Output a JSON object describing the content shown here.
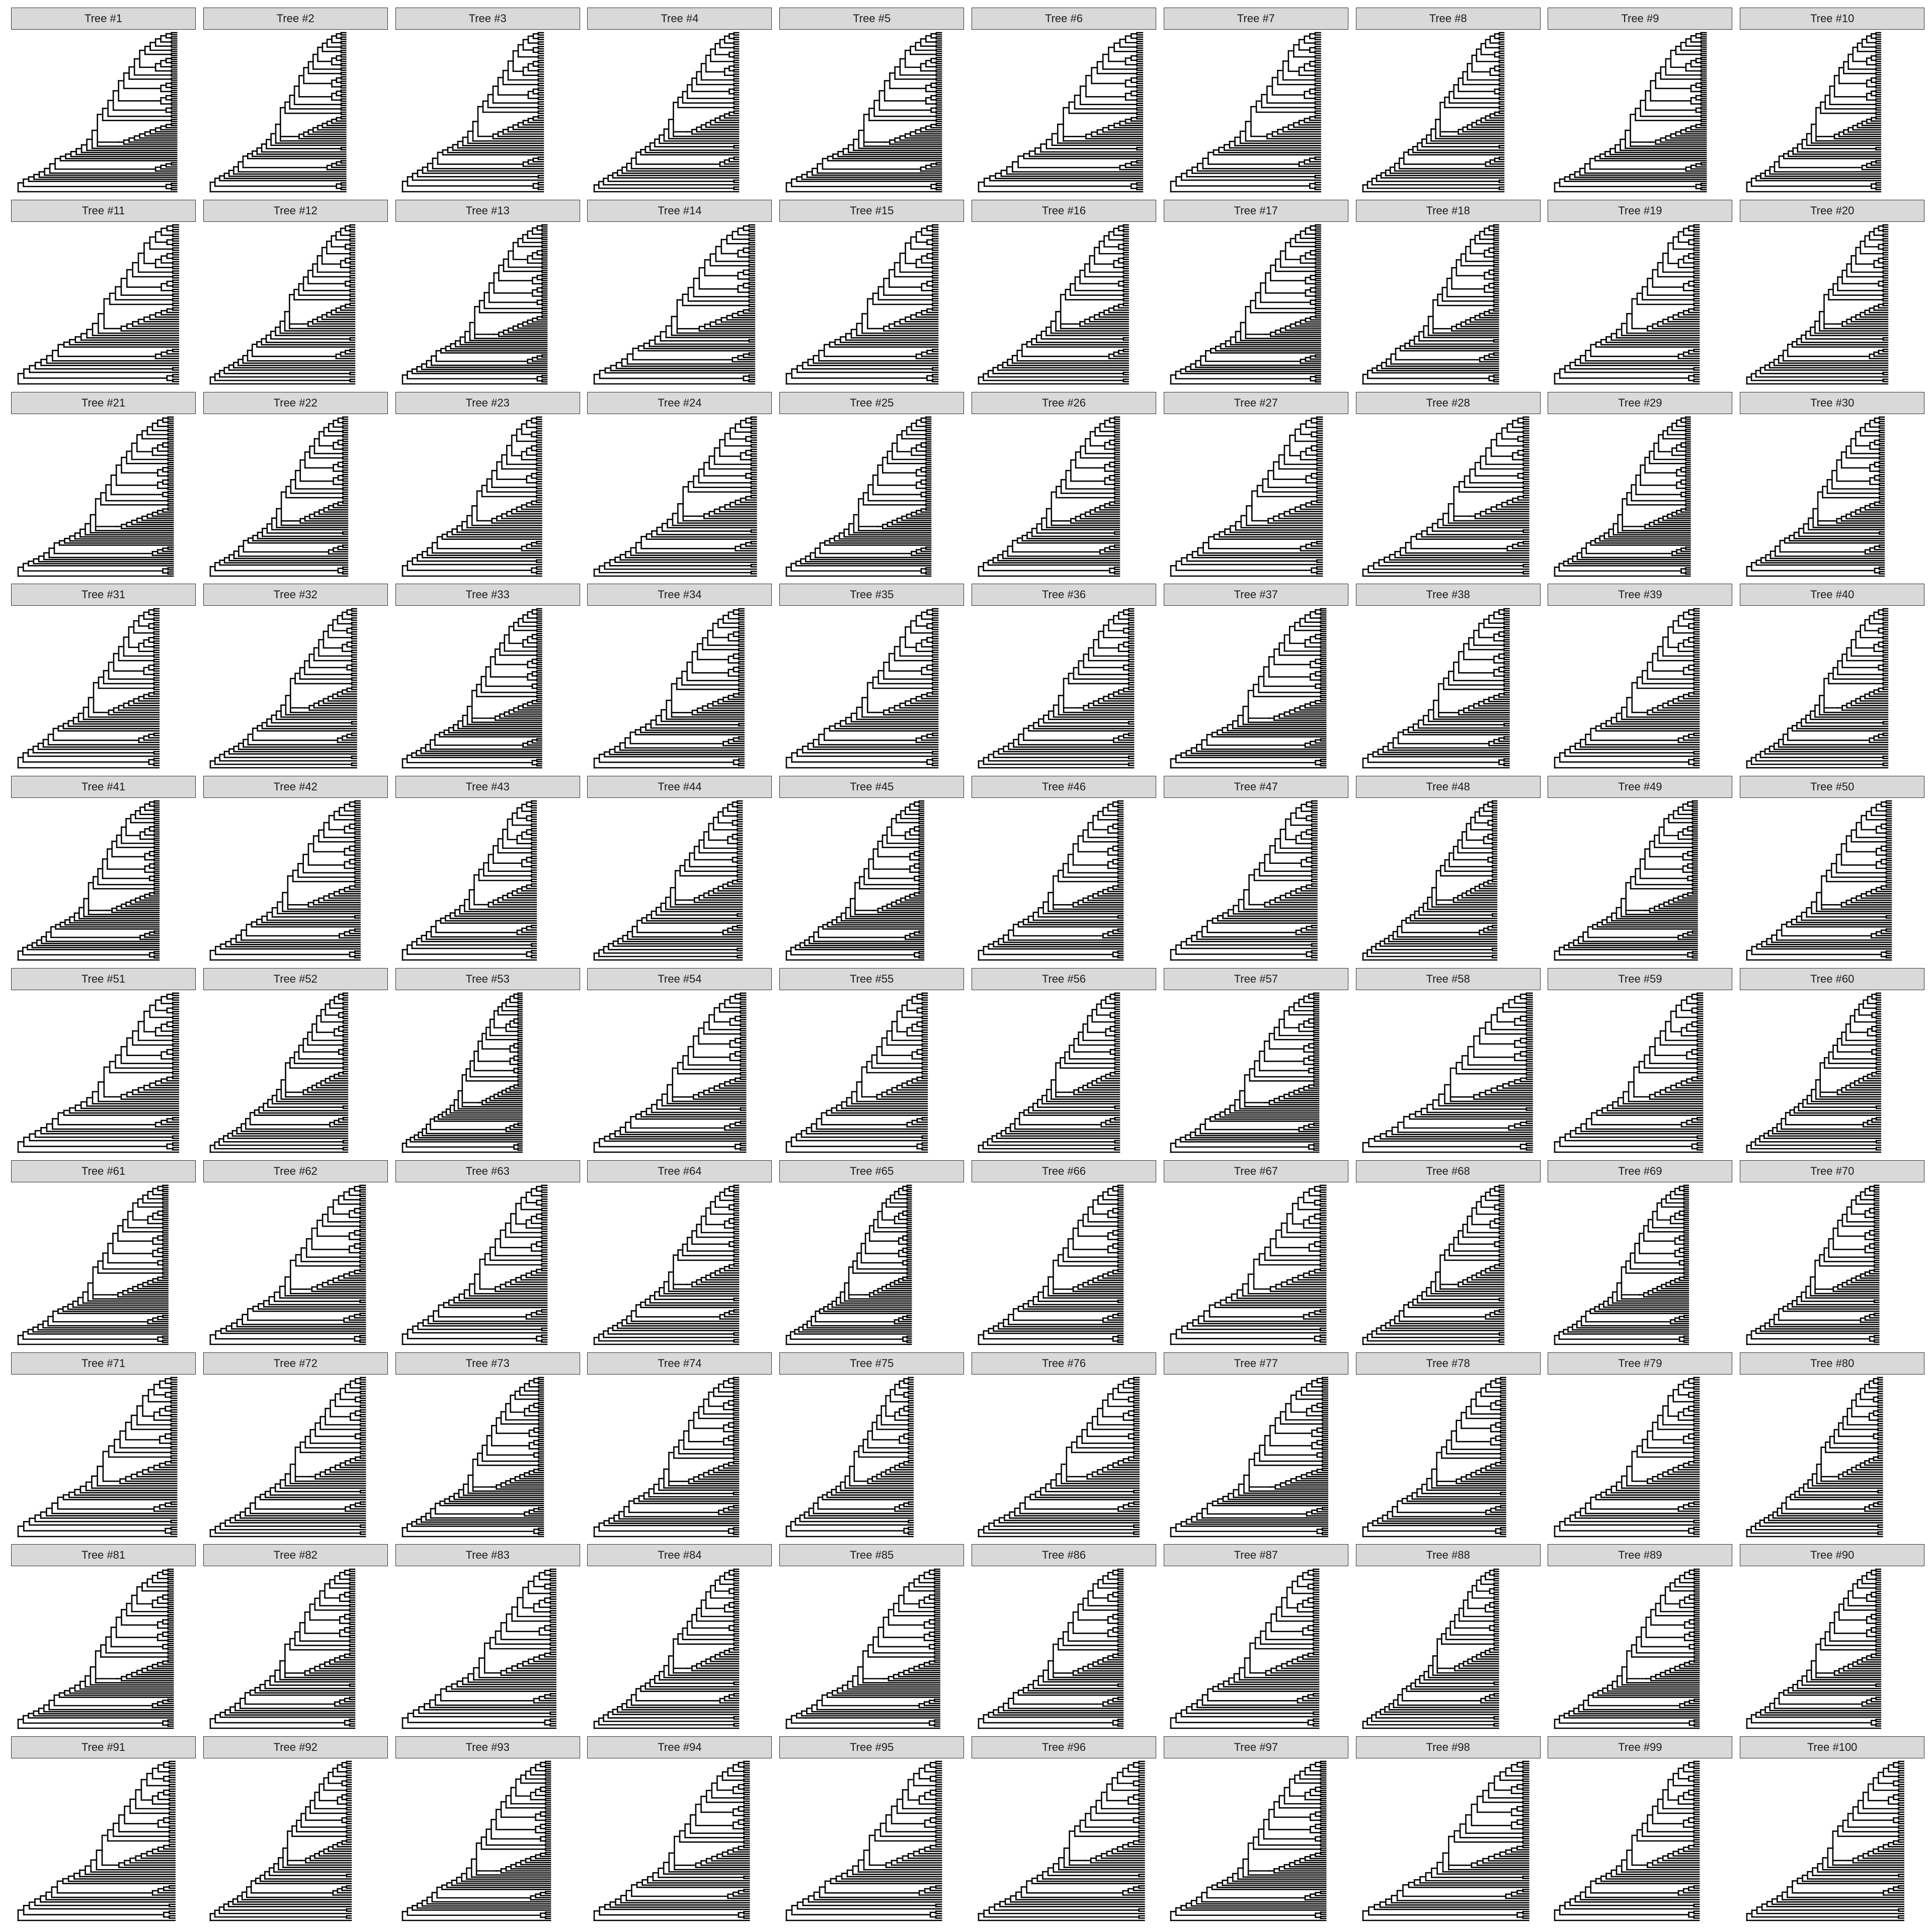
{
  "figure": {
    "title": "",
    "panel_label_prefix": "Tree #",
    "strip_fill": "#d9d9d9",
    "strip_border": "#333333",
    "branch_color": "#000000",
    "columns": 10,
    "rows": 10
  },
  "chart_data": {
    "type": "tree",
    "description": "Faceted grid of 100 ladderized rectangular cladograms",
    "topologies": [
      "((((((((((((((((((((((((((((((A,A),(A,A)),(A,A)),(A,A)),(A,A)),(A,A)),((((A,A),(A,A)),(A,A)),(A,A))),(A,A)),(A,A)),(((A,A),(A,A)),(A,A))),(((A,A),(A,A)),(A,A))),((A,A),(A,A))),(A,A)),(A,A)),(((((((((((A,A),A),A),A),A),A),A),A),A),A)),A),A),A),A),A),A),A),A),((((A,A),A),A),A)),A),A),A),A),A),((A,A),(A,A))),A),(A,A)),A)",
      "(((((((((((((((((((((((((((((A,A),(A,A)),(A,A)),(A,A)),(A,A)),(((A,A),(A,A)),(A,A))),(A,A)),(A,A)),(((A,A),(A,A)),(A,A))),(((A,A),(A,A)),(A,A))),(A,A)),(A,A)),(A,A)),(((((((((((A,A),A),A),A),A),A),A),A),A),A)),A),A),A),(A,A)),A),A),A),A),((((A,A),A),A),A)),A),A),A),A),A),((A,A),(A,A))),A),A)",
      "((((((((((((((((((((((((((((A,A),(A,A)),(A,A)),((A,A),(A,A))),(A,A)),((((A,A),(A,A)),(A,A)),(A,A))),(A,A)),(A,A)),(((A,A),(A,A)),(A,A))),(A,A)),(A,A)),(A,A)),((((((((((A,A),A),A),A),A),A),A),A),A),A)),A),A),A),A),A),A),A),((((A,A),A),A),A)),A),A),A),(A,A)),A),((A,A),(A,A))),A)",
      "(((((((((((((((((((((((((((((((A,A),(A,A)),(A,A)),(A,A)),((A,A),(A,A))),(A,A)),(((A,A),(A,A)),(A,A))),(A,A)),(A,A)),((A,A),(A,A))),(A,A)),(A,A)),(A,A)),(((((((((((A,A),A),A),A),A),A),A),A),A),A)),A),A),A),A),(A,A)),A),A),A),((((A,A),A),A),A)),A),A),A),A),A),(A,A)),A),(A,A)),A),A)"
    ],
    "trees": [
      {
        "label": "Tree #1",
        "topology": 0,
        "tip_extent": 0.91
      },
      {
        "label": "Tree #2",
        "topology": 1,
        "tip_extent": 0.78
      },
      {
        "label": "Tree #3",
        "topology": 2,
        "tip_extent": 0.81
      },
      {
        "label": "Tree #4",
        "topology": 3,
        "tip_extent": 0.83
      },
      {
        "label": "Tree #5",
        "topology": 0,
        "tip_extent": 0.89
      },
      {
        "label": "Tree #6",
        "topology": 1,
        "tip_extent": 0.94
      },
      {
        "label": "Tree #7",
        "topology": 2,
        "tip_extent": 0.86
      },
      {
        "label": "Tree #8",
        "topology": 3,
        "tip_extent": 0.81
      },
      {
        "label": "Tree #9",
        "topology": 0,
        "tip_extent": 0.87
      },
      {
        "label": "Tree #10",
        "topology": 1,
        "tip_extent": 0.77
      },
      {
        "label": "Tree #11",
        "topology": 2,
        "tip_extent": 0.92
      },
      {
        "label": "Tree #12",
        "topology": 3,
        "tip_extent": 0.83
      },
      {
        "label": "Tree #13",
        "topology": 0,
        "tip_extent": 0.83
      },
      {
        "label": "Tree #14",
        "topology": 1,
        "tip_extent": 0.92
      },
      {
        "label": "Tree #15",
        "topology": 2,
        "tip_extent": 0.87
      },
      {
        "label": "Tree #16",
        "topology": 3,
        "tip_extent": 0.86
      },
      {
        "label": "Tree #17",
        "topology": 0,
        "tip_extent": 0.86
      },
      {
        "label": "Tree #18",
        "topology": 1,
        "tip_extent": 0.78
      },
      {
        "label": "Tree #19",
        "topology": 2,
        "tip_extent": 0.83
      },
      {
        "label": "Tree #20",
        "topology": 3,
        "tip_extent": 0.81
      },
      {
        "label": "Tree #21",
        "topology": 0,
        "tip_extent": 0.89
      },
      {
        "label": "Tree #22",
        "topology": 1,
        "tip_extent": 0.79
      },
      {
        "label": "Tree #23",
        "topology": 2,
        "tip_extent": 0.8
      },
      {
        "label": "Tree #24",
        "topology": 3,
        "tip_extent": 0.93
      },
      {
        "label": "Tree #25",
        "topology": 0,
        "tip_extent": 0.83
      },
      {
        "label": "Tree #26",
        "topology": 1,
        "tip_extent": 0.81
      },
      {
        "label": "Tree #27",
        "topology": 2,
        "tip_extent": 0.87
      },
      {
        "label": "Tree #28",
        "topology": 3,
        "tip_extent": 0.95
      },
      {
        "label": "Tree #29",
        "topology": 0,
        "tip_extent": 0.78
      },
      {
        "label": "Tree #30",
        "topology": 1,
        "tip_extent": 0.79
      },
      {
        "label": "Tree #31",
        "topology": 2,
        "tip_extent": 0.81
      },
      {
        "label": "Tree #32",
        "topology": 3,
        "tip_extent": 0.84
      },
      {
        "label": "Tree #33",
        "topology": 0,
        "tip_extent": 0.8
      },
      {
        "label": "Tree #34",
        "topology": 1,
        "tip_extent": 0.86
      },
      {
        "label": "Tree #35",
        "topology": 2,
        "tip_extent": 0.87
      },
      {
        "label": "Tree #36",
        "topology": 3,
        "tip_extent": 0.89
      },
      {
        "label": "Tree #37",
        "topology": 0,
        "tip_extent": 0.89
      },
      {
        "label": "Tree #38",
        "topology": 1,
        "tip_extent": 0.84
      },
      {
        "label": "Tree #39",
        "topology": 2,
        "tip_extent": 0.83
      },
      {
        "label": "Tree #40",
        "topology": 3,
        "tip_extent": 0.81
      },
      {
        "label": "Tree #41",
        "topology": 0,
        "tip_extent": 0.81
      },
      {
        "label": "Tree #42",
        "topology": 1,
        "tip_extent": 0.86
      },
      {
        "label": "Tree #43",
        "topology": 2,
        "tip_extent": 0.77
      },
      {
        "label": "Tree #44",
        "topology": 3,
        "tip_extent": 0.85
      },
      {
        "label": "Tree #45",
        "topology": 0,
        "tip_extent": 0.79
      },
      {
        "label": "Tree #46",
        "topology": 1,
        "tip_extent": 0.83
      },
      {
        "label": "Tree #47",
        "topology": 2,
        "tip_extent": 0.84
      },
      {
        "label": "Tree #48",
        "topology": 3,
        "tip_extent": 0.77
      },
      {
        "label": "Tree #49",
        "topology": 0,
        "tip_extent": 0.82
      },
      {
        "label": "Tree #50",
        "topology": 1,
        "tip_extent": 0.83
      },
      {
        "label": "Tree #51",
        "topology": 2,
        "tip_extent": 0.92
      },
      {
        "label": "Tree #52",
        "topology": 3,
        "tip_extent": 0.79
      },
      {
        "label": "Tree #53",
        "topology": 0,
        "tip_extent": 0.69
      },
      {
        "label": "Tree #54",
        "topology": 1,
        "tip_extent": 0.87
      },
      {
        "label": "Tree #55",
        "topology": 2,
        "tip_extent": 0.81
      },
      {
        "label": "Tree #56",
        "topology": 3,
        "tip_extent": 0.81
      },
      {
        "label": "Tree #57",
        "topology": 0,
        "tip_extent": 0.85
      },
      {
        "label": "Tree #58",
        "topology": 1,
        "tip_extent": 0.97
      },
      {
        "label": "Tree #59",
        "topology": 2,
        "tip_extent": 0.85
      },
      {
        "label": "Tree #60",
        "topology": 3,
        "tip_extent": 0.77
      },
      {
        "label": "Tree #61",
        "topology": 0,
        "tip_extent": 0.86
      },
      {
        "label": "Tree #62",
        "topology": 1,
        "tip_extent": 0.89
      },
      {
        "label": "Tree #63",
        "topology": 2,
        "tip_extent": 0.83
      },
      {
        "label": "Tree #64",
        "topology": 3,
        "tip_extent": 0.83
      },
      {
        "label": "Tree #65",
        "topology": 0,
        "tip_extent": 0.72
      },
      {
        "label": "Tree #66",
        "topology": 1,
        "tip_extent": 0.83
      },
      {
        "label": "Tree #67",
        "topology": 2,
        "tip_extent": 0.89
      },
      {
        "label": "Tree #68",
        "topology": 3,
        "tip_extent": 0.81
      },
      {
        "label": "Tree #69",
        "topology": 0,
        "tip_extent": 0.77
      },
      {
        "label": "Tree #70",
        "topology": 1,
        "tip_extent": 0.76
      },
      {
        "label": "Tree #71",
        "topology": 2,
        "tip_extent": 0.91
      },
      {
        "label": "Tree #72",
        "topology": 3,
        "tip_extent": 0.89
      },
      {
        "label": "Tree #73",
        "topology": 0,
        "tip_extent": 0.81
      },
      {
        "label": "Tree #74",
        "topology": 1,
        "tip_extent": 0.83
      },
      {
        "label": "Tree #75",
        "topology": 2,
        "tip_extent": 0.73
      },
      {
        "label": "Tree #76",
        "topology": 3,
        "tip_extent": 0.92
      },
      {
        "label": "Tree #77",
        "topology": 0,
        "tip_extent": 0.9
      },
      {
        "label": "Tree #78",
        "topology": 1,
        "tip_extent": 0.82
      },
      {
        "label": "Tree #79",
        "topology": 2,
        "tip_extent": 0.83
      },
      {
        "label": "Tree #80",
        "topology": 3,
        "tip_extent": 0.78
      },
      {
        "label": "Tree #81",
        "topology": 0,
        "tip_extent": 0.89
      },
      {
        "label": "Tree #82",
        "topology": 1,
        "tip_extent": 0.83
      },
      {
        "label": "Tree #83",
        "topology": 2,
        "tip_extent": 0.88
      },
      {
        "label": "Tree #84",
        "topology": 3,
        "tip_extent": 0.83
      },
      {
        "label": "Tree #85",
        "topology": 0,
        "tip_extent": 0.88
      },
      {
        "label": "Tree #86",
        "topology": 1,
        "tip_extent": 0.83
      },
      {
        "label": "Tree #87",
        "topology": 2,
        "tip_extent": 0.85
      },
      {
        "label": "Tree #88",
        "topology": 3,
        "tip_extent": 0.78
      },
      {
        "label": "Tree #89",
        "topology": 0,
        "tip_extent": 0.83
      },
      {
        "label": "Tree #90",
        "topology": 1,
        "tip_extent": 0.77
      },
      {
        "label": "Tree #91",
        "topology": 2,
        "tip_extent": 0.9
      },
      {
        "label": "Tree #92",
        "topology": 3,
        "tip_extent": 0.81
      },
      {
        "label": "Tree #93",
        "topology": 0,
        "tip_extent": 0.85
      },
      {
        "label": "Tree #94",
        "topology": 1,
        "tip_extent": 0.89
      },
      {
        "label": "Tree #95",
        "topology": 2,
        "tip_extent": 0.89
      },
      {
        "label": "Tree #96",
        "topology": 3,
        "tip_extent": 0.95
      },
      {
        "label": "Tree #97",
        "topology": 0,
        "tip_extent": 0.89
      },
      {
        "label": "Tree #98",
        "topology": 1,
        "tip_extent": 0.95
      },
      {
        "label": "Tree #99",
        "topology": 2,
        "tip_extent": 0.83
      },
      {
        "label": "Tree #100",
        "topology": 3,
        "tip_extent": 0.9
      }
    ],
    "xlabel": "",
    "ylabel": "",
    "legend": null,
    "grid": false
  }
}
